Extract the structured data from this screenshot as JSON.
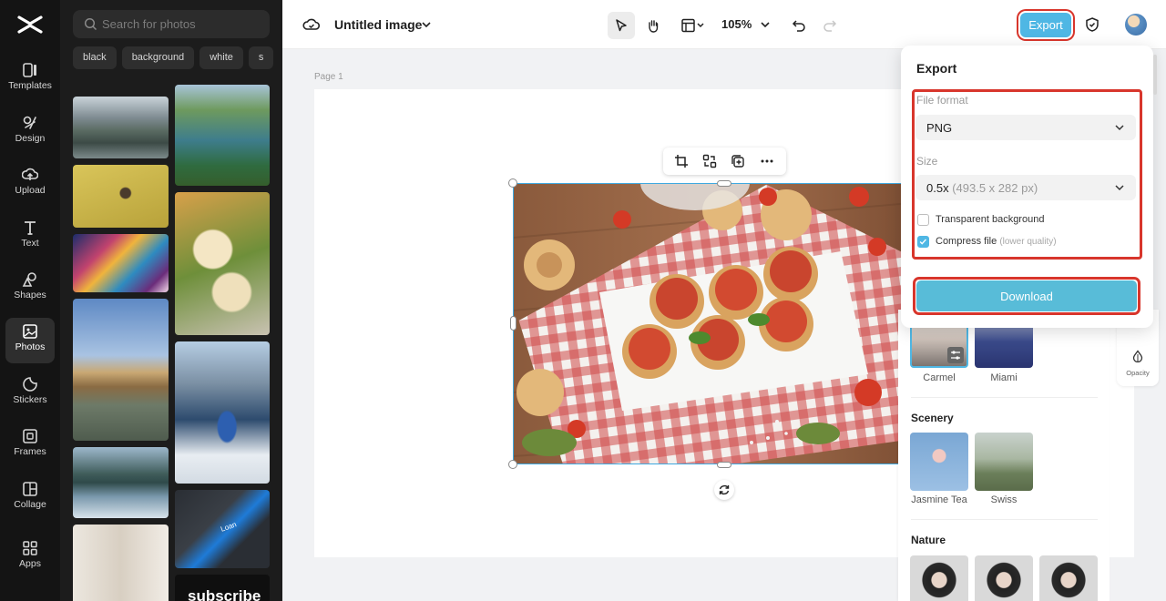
{
  "rail": {
    "items": [
      {
        "label": "Templates",
        "icon": "templates-icon"
      },
      {
        "label": "Design",
        "icon": "design-icon"
      },
      {
        "label": "Upload",
        "icon": "upload-icon"
      },
      {
        "label": "Text",
        "icon": "text-icon"
      },
      {
        "label": "Shapes",
        "icon": "shapes-icon"
      },
      {
        "label": "Photos",
        "icon": "photos-icon",
        "active": true
      },
      {
        "label": "Stickers",
        "icon": "stickers-icon"
      },
      {
        "label": "Frames",
        "icon": "frames-icon"
      },
      {
        "label": "Collage",
        "icon": "collage-icon"
      },
      {
        "label": "Apps",
        "icon": "apps-icon"
      }
    ]
  },
  "photos": {
    "search_placeholder": "Search for photos",
    "chips": [
      "black",
      "background",
      "white",
      "s"
    ],
    "thumb_texts": {
      "loan": "Loan",
      "subscribe": "subscribe"
    }
  },
  "topbar": {
    "title": "Untitled image",
    "zoom": "105%",
    "export_label": "Export"
  },
  "canvas": {
    "page_label": "Page 1"
  },
  "export_panel": {
    "title": "Export",
    "file_format_label": "File format",
    "file_format_value": "PNG",
    "size_label": "Size",
    "size_value": "0.5x",
    "size_detail": "(493.5 x 282 px)",
    "transparent_label": "Transparent background",
    "transparent_checked": false,
    "compress_label": "Compress file",
    "compress_note": "(lower quality)",
    "compress_checked": true,
    "download_label": "Download",
    "highlight_color": "#d8362c",
    "accent_color": "#4fb7e4"
  },
  "filters": {
    "top_items": [
      "Carmel",
      "Miami"
    ],
    "sections": [
      {
        "title": "Scenery",
        "items": [
          "Jasmine Tea",
          "Swiss"
        ]
      },
      {
        "title": "Nature",
        "items": []
      }
    ]
  },
  "side_tools": {
    "opacity_label": "Opacity"
  }
}
